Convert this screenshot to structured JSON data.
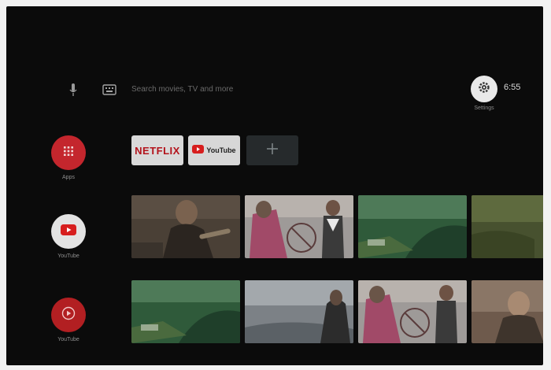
{
  "top_bar": {
    "search_placeholder": "Search movies, TV and more",
    "settings_label": "Settings",
    "clock": "6:55",
    "icons": [
      "mic-icon",
      "keyboard-icon",
      "gear-icon"
    ]
  },
  "rail": [
    {
      "label": "Apps",
      "icon": "apps-grid-icon",
      "color": "#c4262d"
    },
    {
      "label": "YouTube",
      "icon": "youtube-play-icon",
      "color": "#e3e3e3"
    },
    {
      "label": "YouTube",
      "icon": "youtube-music-play-icon",
      "color": "#b21f22"
    }
  ],
  "favorites": [
    {
      "label": "NETFLIX",
      "color": "#b3121b"
    },
    {
      "label": "YouTube",
      "color": "#d71e1e"
    },
    {
      "label": "+",
      "icon": "add-icon"
    }
  ],
  "colors": {
    "background": "#0b0b0b",
    "accent_red": "#c4262d",
    "tile_gray": "#d9d9d9"
  }
}
